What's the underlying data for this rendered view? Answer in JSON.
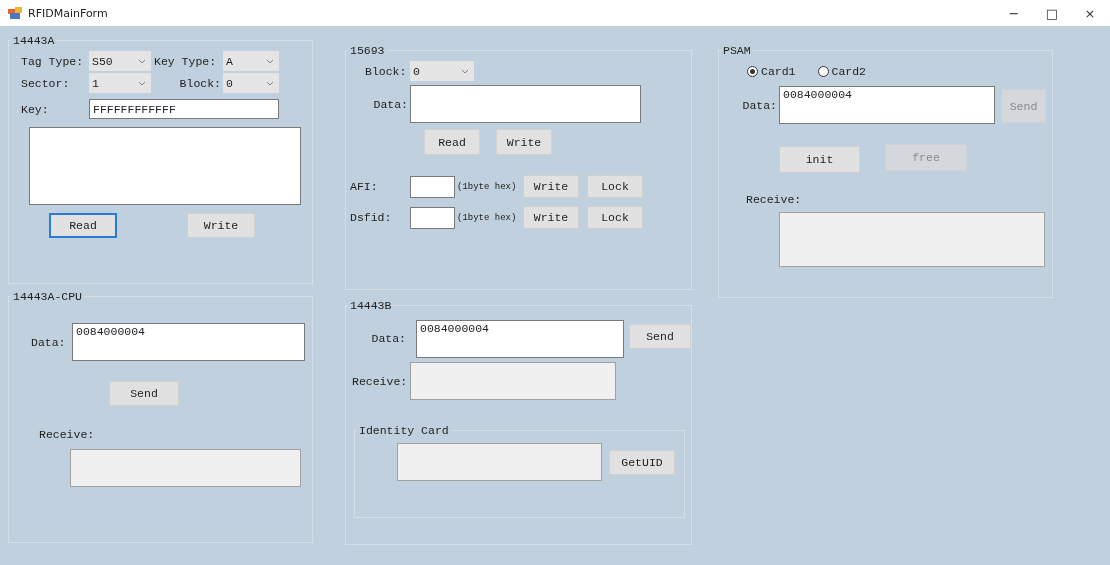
{
  "window": {
    "title": "RFIDMainForm",
    "controls": [
      "−",
      "□",
      "×"
    ]
  },
  "iso14443a": {
    "title": "14443A",
    "tag_type": {
      "label": "Tag Type:",
      "value": "S50"
    },
    "key_type": {
      "label": "Key Type:",
      "value": "A"
    },
    "sector": {
      "label": "Sector:",
      "value": "1"
    },
    "block": {
      "label": "Block:",
      "value": "0"
    },
    "key": {
      "label": "Key:",
      "value": "FFFFFFFFFFFF"
    },
    "buttons": [
      {
        "label": "Read",
        "focused": true,
        "disabled": false
      },
      {
        "label": "Write",
        "focused": false,
        "disabled": false
      }
    ]
  },
  "iso14443a_cpu": {
    "title": "14443A-CPU",
    "data": {
      "label": "Data:",
      "value": "0084000004"
    },
    "send": {
      "label": "Send",
      "focused": false,
      "disabled": false
    },
    "receive": {
      "label": "Receive:"
    }
  },
  "iso15693": {
    "title": "15693",
    "block": {
      "label": "Block:",
      "value": "0"
    },
    "data": {
      "label": "Data:"
    },
    "buttons": [
      {
        "label": "Read",
        "focused": false,
        "disabled": false
      },
      {
        "label": "Write",
        "focused": false,
        "disabled": false
      }
    ],
    "afi": {
      "label": "AFI:",
      "hint": "(1byte hex)",
      "buttons": [
        {
          "label": "Write",
          "focused": false,
          "disabled": false
        },
        {
          "label": "Lock",
          "focused": false,
          "disabled": false
        }
      ]
    },
    "dsfid": {
      "label": "Dsfid:",
      "hint": "(1byte hex)",
      "buttons": [
        {
          "label": "Write",
          "focused": false,
          "disabled": false
        },
        {
          "label": "Lock",
          "focused": false,
          "disabled": false
        }
      ]
    }
  },
  "iso14443b": {
    "title": "14443B",
    "data": {
      "label": "Data:",
      "value": "0084000004"
    },
    "send": {
      "label": "Send",
      "focused": false,
      "disabled": false
    },
    "receive": {
      "label": "Receive:"
    },
    "identity_card": {
      "title": "Identity Card",
      "button": {
        "label": "GetUID",
        "focused": false,
        "disabled": false
      }
    }
  },
  "psam": {
    "title": "PSAM",
    "cards": [
      {
        "label": "Card1",
        "selected": true
      },
      {
        "label": "Card2",
        "selected": false
      }
    ],
    "data": {
      "label": "Data:",
      "value": "0084000004"
    },
    "send": {
      "label": "Send",
      "focused": false,
      "disabled": true
    },
    "init": {
      "label": "init",
      "focused": false,
      "disabled": false
    },
    "free": {
      "label": "free",
      "focused": false,
      "disabled": true
    },
    "receive": {
      "label": "Receive:"
    }
  }
}
